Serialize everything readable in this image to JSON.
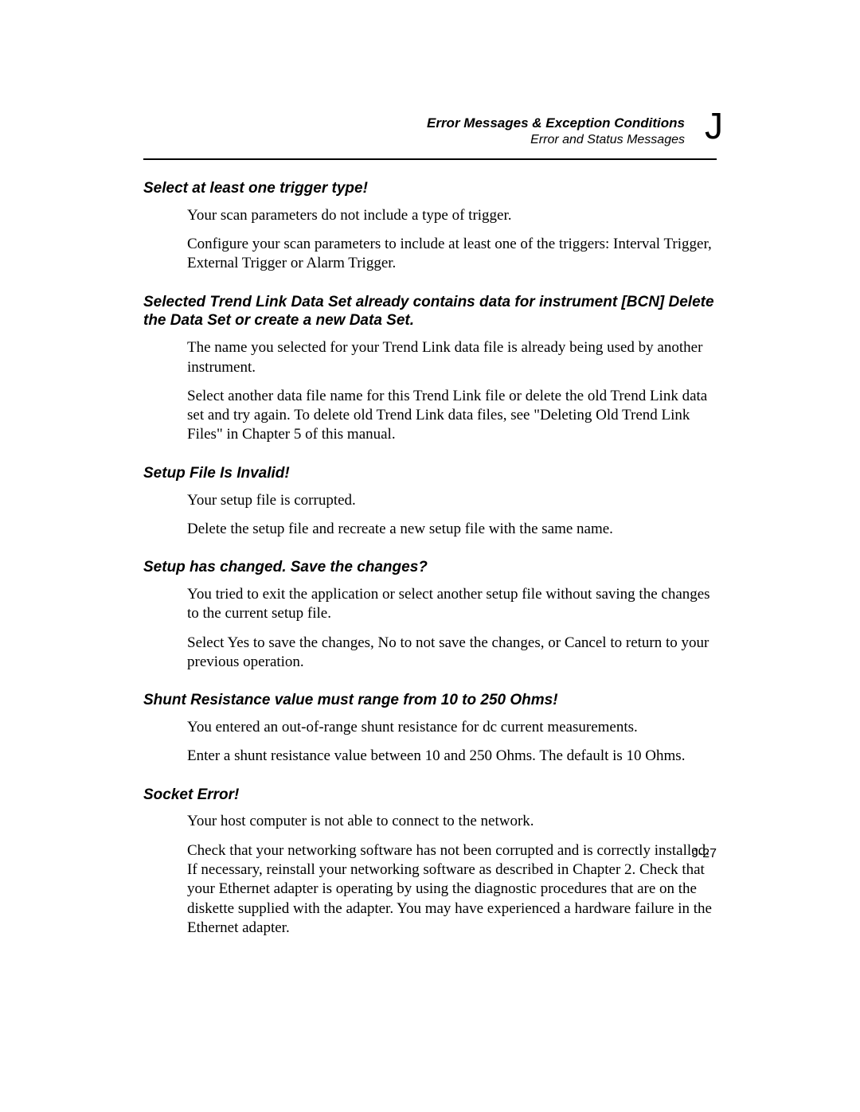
{
  "header": {
    "title": "Error Messages & Exception Conditions",
    "subtitle": "Error and Status Messages",
    "appendix_letter": "J"
  },
  "sections": [
    {
      "heading": "Select at least one trigger type!",
      "paragraphs": [
        "Your scan parameters do not include a type of trigger.",
        "Configure your scan parameters to include at least one of the triggers: Interval Trigger, External Trigger or Alarm Trigger."
      ]
    },
    {
      "heading": "Selected Trend Link Data Set already contains data for instrument [BCN]  Delete the Data Set or create a new Data Set.",
      "paragraphs": [
        "The name you selected for your Trend Link data file is already being used by another instrument.",
        "Select another data file name for this Trend Link file or delete the old Trend Link data set and try again. To delete old Trend Link data files, see \"Deleting Old Trend Link Files\" in Chapter 5 of this manual."
      ]
    },
    {
      "heading": "Setup File Is Invalid!",
      "paragraphs": [
        "Your setup file is corrupted.",
        "Delete the setup file and recreate a new setup file with the same name."
      ]
    },
    {
      "heading": "Setup has changed.  Save the changes?",
      "paragraphs": [
        "You tried to exit the application or select another setup file without saving the changes to the current setup file.",
        "Select Yes to save the changes, No to not save the changes, or Cancel to return to your previous operation."
      ]
    },
    {
      "heading": "Shunt Resistance value must range from 10 to 250 Ohms!",
      "paragraphs": [
        "You entered an out-of-range shunt resistance for dc current measurements.",
        "Enter a shunt resistance value between 10 and 250 Ohms. The default is 10 Ohms."
      ]
    },
    {
      "heading": "Socket Error!",
      "paragraphs": [
        "Your host computer is not able to connect to the network.",
        "Check that your networking software has not been corrupted and is correctly installed. If necessary, reinstall your networking software as described in Chapter 2. Check that your Ethernet adapter is operating by using the diagnostic procedures that are on the diskette supplied with the adapter. You may have experienced a hardware failure in the Ethernet adapter."
      ]
    }
  ],
  "page_number": "J-27"
}
